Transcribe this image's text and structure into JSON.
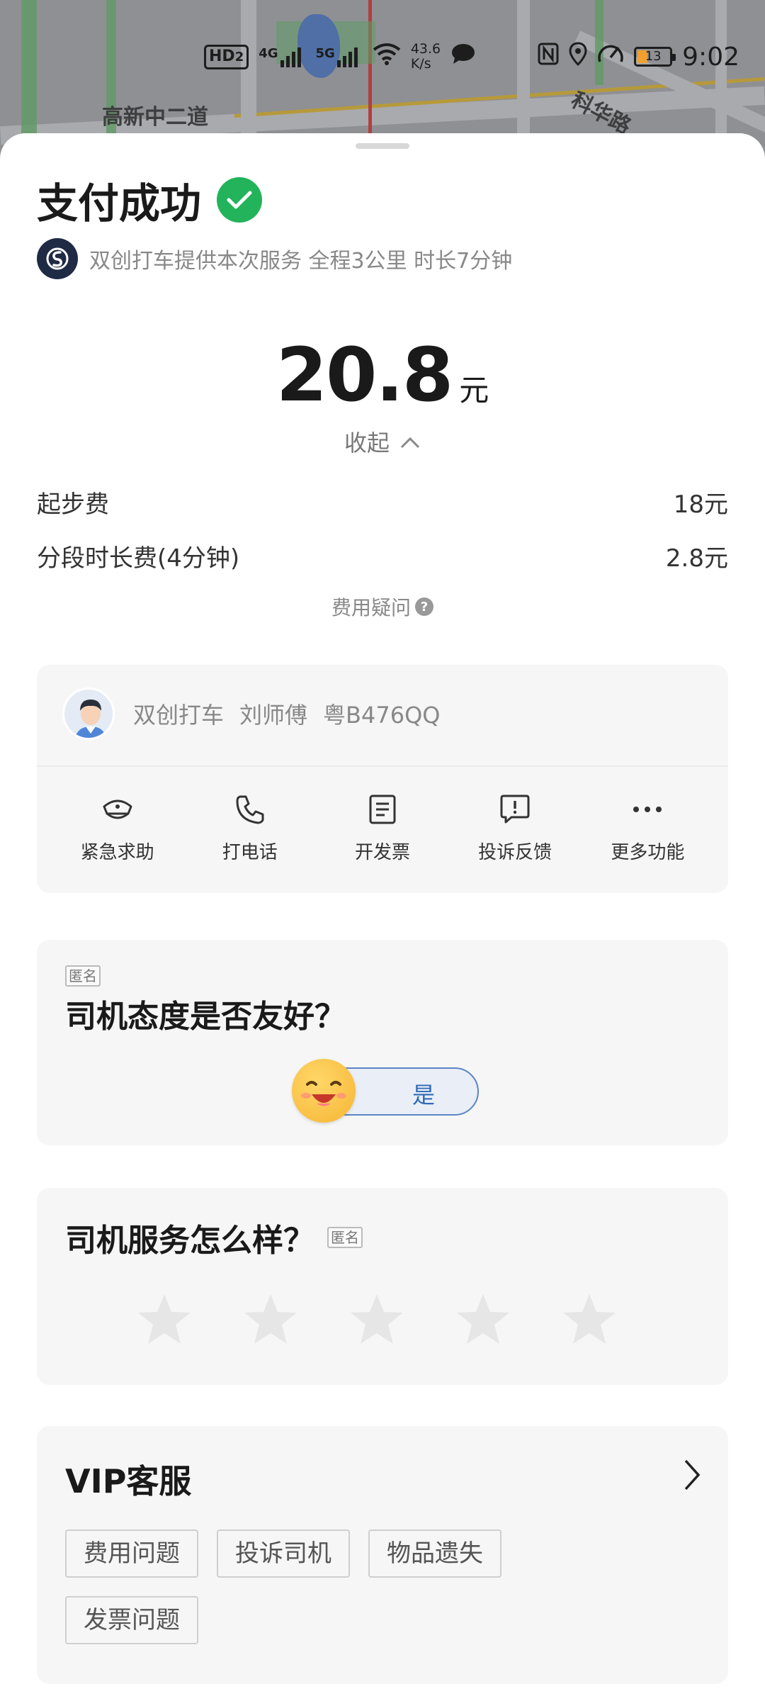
{
  "map": {
    "labels": [
      "高新中二道",
      "科华路"
    ]
  },
  "status_bar": {
    "hd": "HD",
    "hd_sub": "2",
    "net1": "4G",
    "net2": "5G",
    "speed": "43.6",
    "speed_unit": "K/s",
    "battery": "13",
    "time": "9:02"
  },
  "header": {
    "title": "支付成功",
    "service_text": "双创打车提供本次服务 全程3公里 时长7分钟"
  },
  "amount": {
    "value": "20.8",
    "unit": "元"
  },
  "collapse_label": "收起",
  "fees": [
    {
      "name": "起步费",
      "value": "18元"
    },
    {
      "name": "分段时长费(4分钟)",
      "value": "2.8元"
    }
  ],
  "fee_question": "费用疑问",
  "driver": {
    "company": "双创打车",
    "name": "刘师傅",
    "plate": "粤B476QQ"
  },
  "actions": [
    {
      "label": "紧急求助",
      "icon": "police-cap-icon"
    },
    {
      "label": "打电话",
      "icon": "phone-icon"
    },
    {
      "label": "开发票",
      "icon": "invoice-icon"
    },
    {
      "label": "投诉反馈",
      "icon": "complaint-icon"
    },
    {
      "label": "更多功能",
      "icon": "more-icon"
    }
  ],
  "attitude": {
    "anonymous": "匿名",
    "question": "司机态度是否友好？",
    "yes_label": "是"
  },
  "service_rating": {
    "question": "司机服务怎么样？",
    "anonymous": "匿名",
    "stars": 5,
    "selected": 0
  },
  "vip": {
    "title": "VIP客服",
    "tags": [
      "费用问题",
      "投诉司机",
      "物品遗失",
      "发票问题"
    ]
  },
  "colors": {
    "success_green": "#22b35b",
    "accent_blue": "#2f69b8",
    "card_bg": "#f6f6f6"
  }
}
